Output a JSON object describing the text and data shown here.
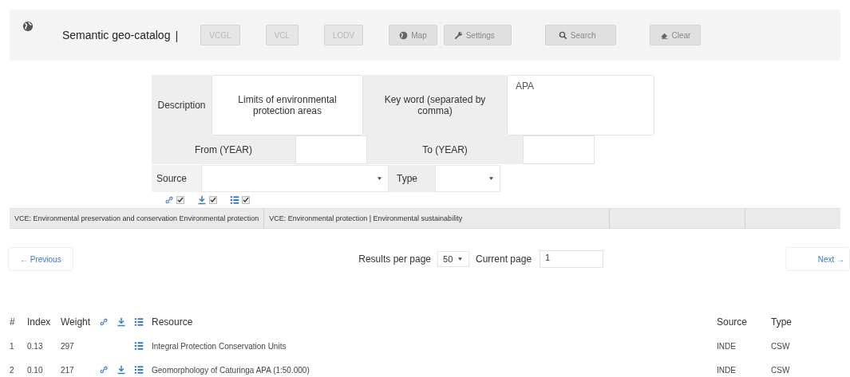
{
  "toolbar": {
    "title": "Semantic geo-catalog",
    "separator": "|",
    "buttons": [
      {
        "label": "VCGL",
        "kind": "text",
        "disabled": true
      },
      {
        "label": "VCL",
        "kind": "text",
        "disabled": true
      },
      {
        "label": "LODV",
        "kind": "text",
        "disabled": true
      },
      {
        "label": "Map",
        "kind": "globe",
        "disabled": false
      },
      {
        "label": "Settings",
        "kind": "wrench",
        "disabled": false
      },
      {
        "label": "Search",
        "kind": "search",
        "disabled": false
      },
      {
        "label": "Clear",
        "kind": "eraser",
        "disabled": false
      }
    ]
  },
  "form": {
    "description_label": "Description",
    "description_value": "Limits of environmental protection areas",
    "keyword_label": "Key word (separated by comma)",
    "keyword_value": "APA",
    "from_label": "From (YEAR)",
    "to_label": "To (YEAR)",
    "source_label": "Source",
    "type_label": "Type",
    "filters": [
      {
        "kind": "link",
        "checked": true
      },
      {
        "kind": "download",
        "checked": true
      },
      {
        "kind": "list",
        "checked": true
      }
    ]
  },
  "tags": [
    "VCE: Environmental preservation and conservation Environmental protection",
    "VCE: Environmental protection | Environmental sustainability"
  ],
  "pagination": {
    "previous": "← Previous",
    "results_label": "Results per page",
    "results_value": "50",
    "current_label": "Current page",
    "current_value": "1",
    "next": "Next →"
  },
  "table": {
    "columns": [
      "#",
      "Index",
      "Weight",
      "Resource",
      "Source",
      "Type"
    ],
    "rows": [
      {
        "num": "1",
        "index": "0.13",
        "weight": "297",
        "link": false,
        "download": false,
        "list": true,
        "resource": "Integral Protection Conservation Units",
        "source": "INDE",
        "type": "CSW"
      },
      {
        "num": "2",
        "index": "0.10",
        "weight": "217",
        "link": true,
        "download": true,
        "list": true,
        "resource": "Geomorphology of Caturinga APA (1:50.000)",
        "source": "INDE",
        "type": "CSW"
      }
    ]
  }
}
